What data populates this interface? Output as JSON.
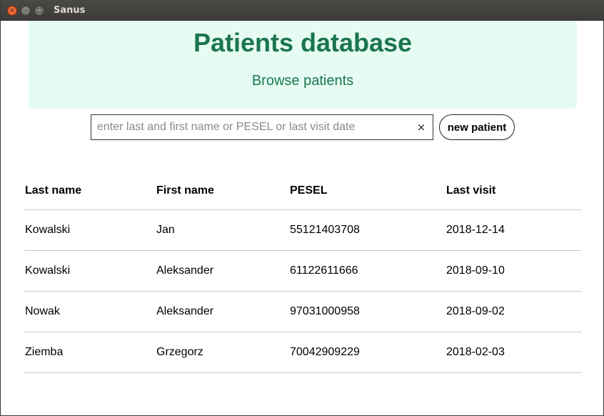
{
  "window": {
    "title": "Sanus",
    "close_glyph": "×",
    "minimize_glyph": "–",
    "maximize_glyph": "□"
  },
  "header": {
    "title": "Patients database",
    "subtitle": "Browse patients"
  },
  "search": {
    "value": "",
    "placeholder": "enter last and first name or PESEL or last visit date",
    "clear_glyph": "×"
  },
  "actions": {
    "new_patient_label": "new patient"
  },
  "table": {
    "columns": [
      "Last name",
      "First name",
      "PESEL",
      "Last visit"
    ],
    "rows": [
      [
        "Kowalski",
        "Jan",
        "55121403708",
        "2018-12-14"
      ],
      [
        "Kowalski",
        "Aleksander",
        "61122611666",
        "2018-09-10"
      ],
      [
        "Nowak",
        "Aleksander",
        "97031000958",
        "2018-09-02"
      ],
      [
        "Ziemba",
        "Grzegorz",
        "70042909229",
        "2018-02-03"
      ]
    ]
  },
  "colors": {
    "accent": "#1a7550",
    "header_bg": "#e6fcf3",
    "titlebar_bg": "#3c3b37",
    "close_button": "#e0501c"
  }
}
